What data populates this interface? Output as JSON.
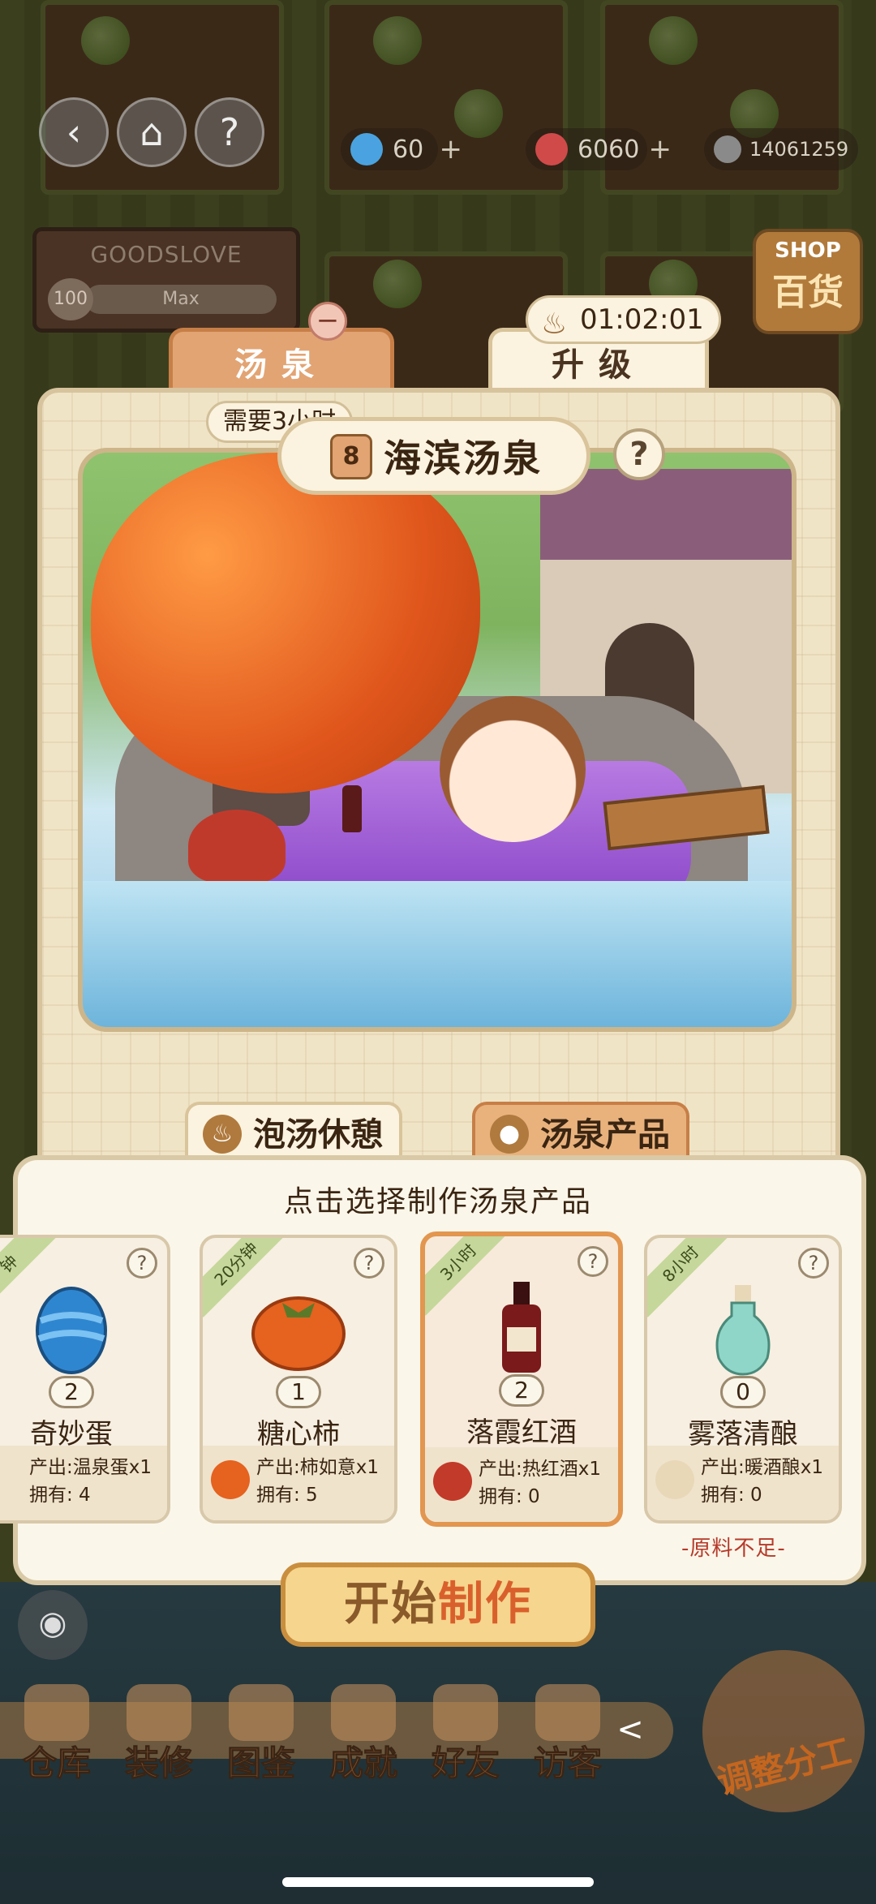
{
  "hud": {
    "back_icon": "back-arrow-icon",
    "home_icon": "home-icon",
    "help_label": "?",
    "resources": [
      {
        "name": "gem",
        "value": "60",
        "color": "#4aa3e0"
      },
      {
        "name": "ruby",
        "value": "6060",
        "color": "#d04a4a"
      },
      {
        "name": "coin",
        "value": "14061259",
        "color": "#8a8a8a"
      }
    ],
    "plus": "+"
  },
  "sign": {
    "name": "GOODSLOVE",
    "level": "100",
    "status": "Max"
  },
  "shop": {
    "label_en": "SHOP",
    "label_cn": "百货"
  },
  "tabs": [
    {
      "label": "汤泉",
      "active": true
    },
    {
      "label": "升级",
      "active": false
    }
  ],
  "spring": {
    "level": "8",
    "title": "海滨汤泉",
    "help": "?",
    "need_chip": "需要3小时",
    "timer": "01:02:01",
    "minus": "−"
  },
  "subtabs": [
    {
      "label": "泡汤休憩",
      "icon": "steam-icon"
    },
    {
      "label": "汤泉产品",
      "icon": "bean-icon"
    }
  ],
  "products": {
    "prompt": "点击选择制作汤泉产品",
    "items": [
      {
        "corner": "钟",
        "count": "2",
        "name": "奇妙蛋",
        "output": "产出:温泉蛋x1",
        "owned": "拥有: 4",
        "icon": "egg-icon",
        "color": "#2f86d0"
      },
      {
        "corner": "20分钟",
        "count": "1",
        "name": "糖心柿",
        "output": "产出:柿如意x1",
        "owned": "拥有: 5",
        "icon": "persimmon-icon",
        "color": "#e5621f"
      },
      {
        "corner": "3小时",
        "count": "2",
        "name": "落霞红酒",
        "output": "产出:热红酒x1",
        "owned": "拥有: 0",
        "icon": "wine-bottle-icon",
        "color": "#7a1a1a",
        "selected": true
      },
      {
        "corner": "8小时",
        "count": "0",
        "name": "雾落清酿",
        "output": "产出:暖酒酿x1",
        "owned": "拥有: 0",
        "icon": "flask-icon",
        "color": "#8fd6c8"
      }
    ],
    "shortage": "-原料不足-"
  },
  "start_button": {
    "part1": "开始",
    "part2": "制作"
  },
  "eye_icon": "eye-icon",
  "nav": [
    {
      "label": "仓库",
      "icon": "warehouse-icon"
    },
    {
      "label": "装修",
      "icon": "decorate-icon"
    },
    {
      "label": "图鉴",
      "icon": "catalog-icon"
    },
    {
      "label": "成就",
      "icon": "trophy-icon"
    },
    {
      "label": "好友",
      "icon": "friends-icon"
    },
    {
      "label": "访客",
      "icon": "visitor-icon"
    }
  ],
  "nav_arrow": "<",
  "adjust_label": "调整分工"
}
